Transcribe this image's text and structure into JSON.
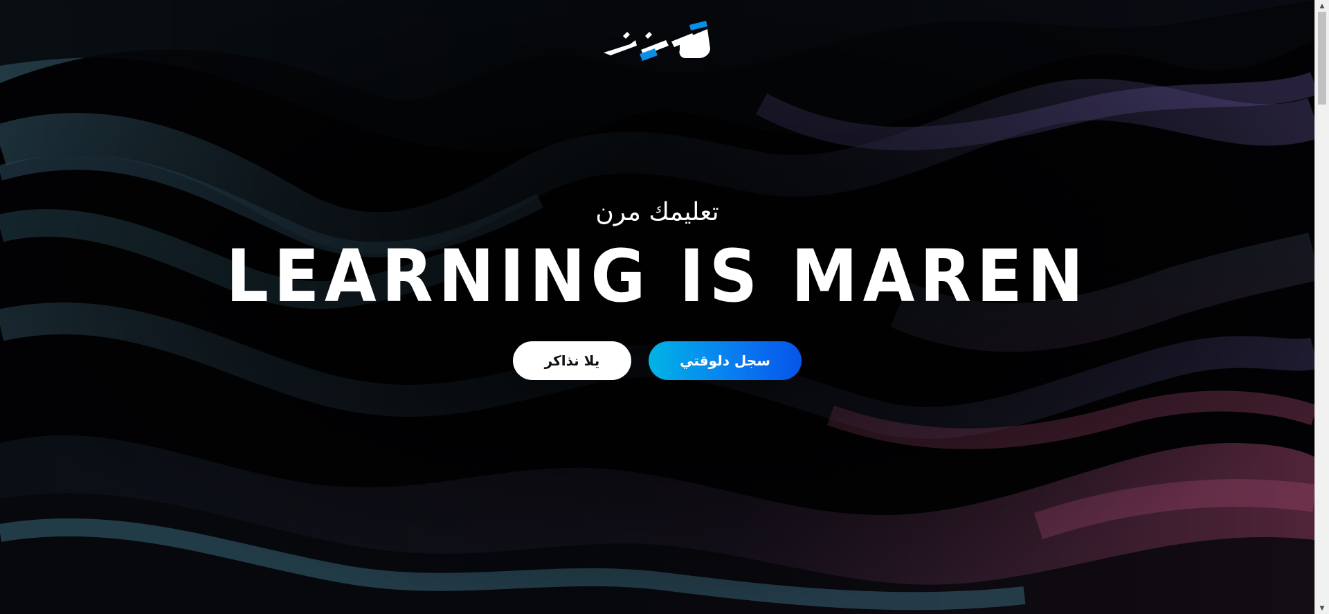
{
  "brand": {
    "logo_icon": "maren-logo-icon",
    "accent_color": "#0a8fe6"
  },
  "hero": {
    "tagline": "تعليمك مرن",
    "headline": "LEARNING IS MAREN"
  },
  "actions": {
    "register_label": "سجل دلوقتي",
    "study_label": "يلا نذاكر"
  },
  "colors": {
    "background": "#020204",
    "primary_gradient_start": "#00b4e6",
    "primary_gradient_end": "#0555ea",
    "secondary_button": "#ffffff",
    "wave_teal": "#3c6e82",
    "wave_pink": "#b4507a",
    "wave_purple": "#6a5aa0"
  },
  "scrollbar": {
    "icon_up": "scroll-up-arrow-icon",
    "icon_down": "scroll-down-arrow-icon"
  }
}
